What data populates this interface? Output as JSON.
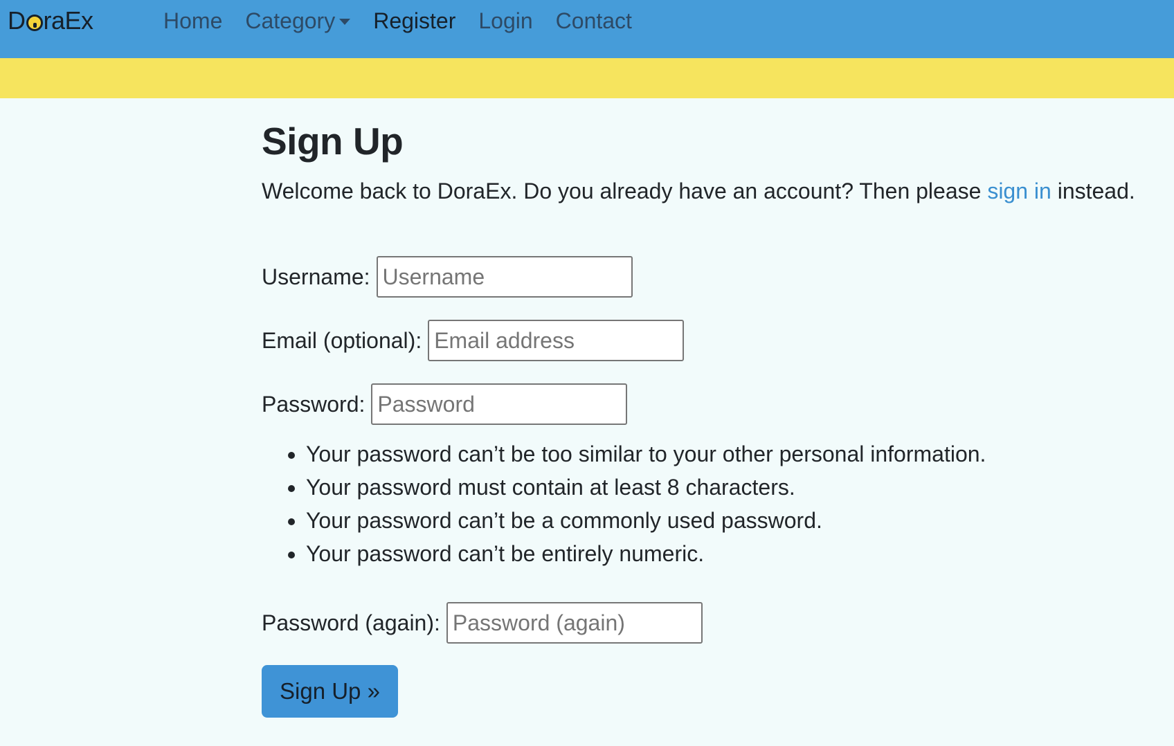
{
  "nav": {
    "brand_prefix": "D",
    "brand_suffix": "raEx",
    "brand_full": "DoraEx",
    "links": [
      {
        "label": "Home"
      },
      {
        "label": "Category"
      },
      {
        "label": "Register"
      },
      {
        "label": "Login"
      },
      {
        "label": "Contact"
      }
    ]
  },
  "page": {
    "title": "Sign Up",
    "intro_text": "Welcome back to DoraEx. Do you already have an account? Then please ",
    "intro_link": "sign in",
    "intro_tail": " instead."
  },
  "form": {
    "username": {
      "label": "Username:",
      "placeholder": "Username"
    },
    "email": {
      "label": "Email (optional):",
      "placeholder": "Email address"
    },
    "password": {
      "label": "Password:",
      "placeholder": "Password"
    },
    "password_help": [
      "Your password can’t be too similar to your other personal information.",
      "Your password must contain at least 8 characters.",
      "Your password can’t be a commonly used password.",
      "Your password can’t be entirely numeric."
    ],
    "password2": {
      "label": "Password (again):",
      "placeholder": "Password (again)"
    },
    "submit_label": "Sign Up »"
  },
  "colors": {
    "navbar": "#469cd9",
    "banner": "#f6e45e",
    "background": "#f2fbfb",
    "link": "#3a8fd0",
    "button": "#3f93d6"
  }
}
